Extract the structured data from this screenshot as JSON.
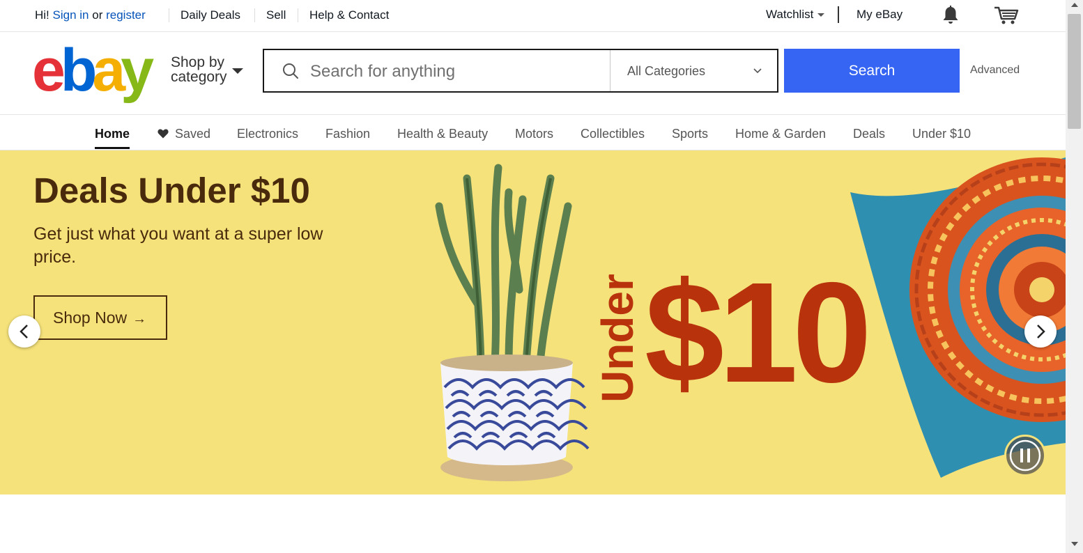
{
  "topbar": {
    "greeting_prefix": "Hi!",
    "sign_in": "Sign in",
    "or_text": "or",
    "register": "register",
    "daily_deals": "Daily Deals",
    "sell": "Sell",
    "help_contact": "Help & Contact",
    "watchlist": "Watchlist",
    "my_ebay": "My eBay",
    "icons": [
      "bell-icon",
      "cart-icon"
    ]
  },
  "header": {
    "logo": {
      "e": "e",
      "b": "b",
      "a": "a",
      "y": "y"
    },
    "shop_by_line1": "Shop by",
    "shop_by_line2": "category",
    "search_placeholder": "Search for anything",
    "category_select": "All Categories",
    "search_button": "Search",
    "advanced": "Advanced"
  },
  "nav": {
    "items": [
      {
        "label": "Home"
      },
      {
        "label": "Saved"
      },
      {
        "label": "Electronics"
      },
      {
        "label": "Fashion"
      },
      {
        "label": "Health & Beauty"
      },
      {
        "label": "Motors"
      },
      {
        "label": "Collectibles"
      },
      {
        "label": "Sports"
      },
      {
        "label": "Home & Garden"
      },
      {
        "label": "Deals"
      },
      {
        "label": "Under $10"
      }
    ],
    "active": "Home"
  },
  "hero": {
    "title": "Deals Under $10",
    "subtitle": "Get just what you want at a super low price.",
    "cta": "Shop Now",
    "art_under": "Under",
    "art_price": "$10",
    "colors": {
      "background": "#f5e27a",
      "text": "#4a2a0c",
      "price": "#b8320c"
    }
  },
  "colors": {
    "link_blue": "#0654ba",
    "search_blue": "#3665f3"
  }
}
